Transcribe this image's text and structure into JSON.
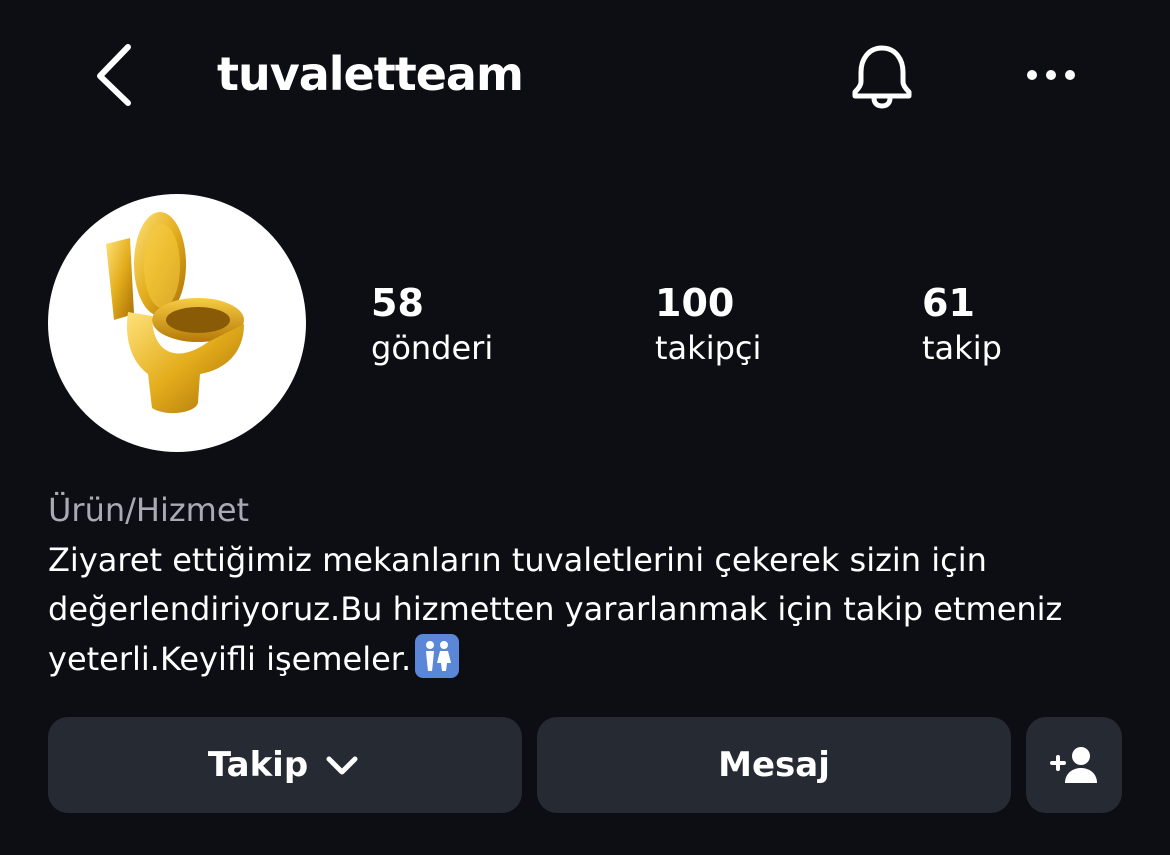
{
  "header": {
    "username": "tuvaletteam",
    "icons": {
      "back": "chevron-left-icon",
      "notifications": "bell-icon",
      "more": "more-dots-icon"
    }
  },
  "profile": {
    "avatar": "golden-toilet-image",
    "stats": [
      {
        "value": "58",
        "label": "gönderi"
      },
      {
        "value": "100",
        "label": "takipçi"
      },
      {
        "value": "61",
        "label": "takip"
      }
    ],
    "category": "Ürün/Hizmet",
    "bio": "Ziyaret ettiğimiz mekanların tuvaletlerini çekerek sizin için değerlendiriyoruz.Bu hizmetten yararlanmak için takip etmeniz yeterli.Keyifli işemeler.",
    "bio_emoji": "restroom-icon"
  },
  "actions": {
    "follow_label": "Takip",
    "message_label": "Mesaj",
    "add_friend_icon": "add-person-icon"
  },
  "colors": {
    "background": "#0c0e13",
    "button": "#262a33",
    "category": "#a8abb3"
  }
}
